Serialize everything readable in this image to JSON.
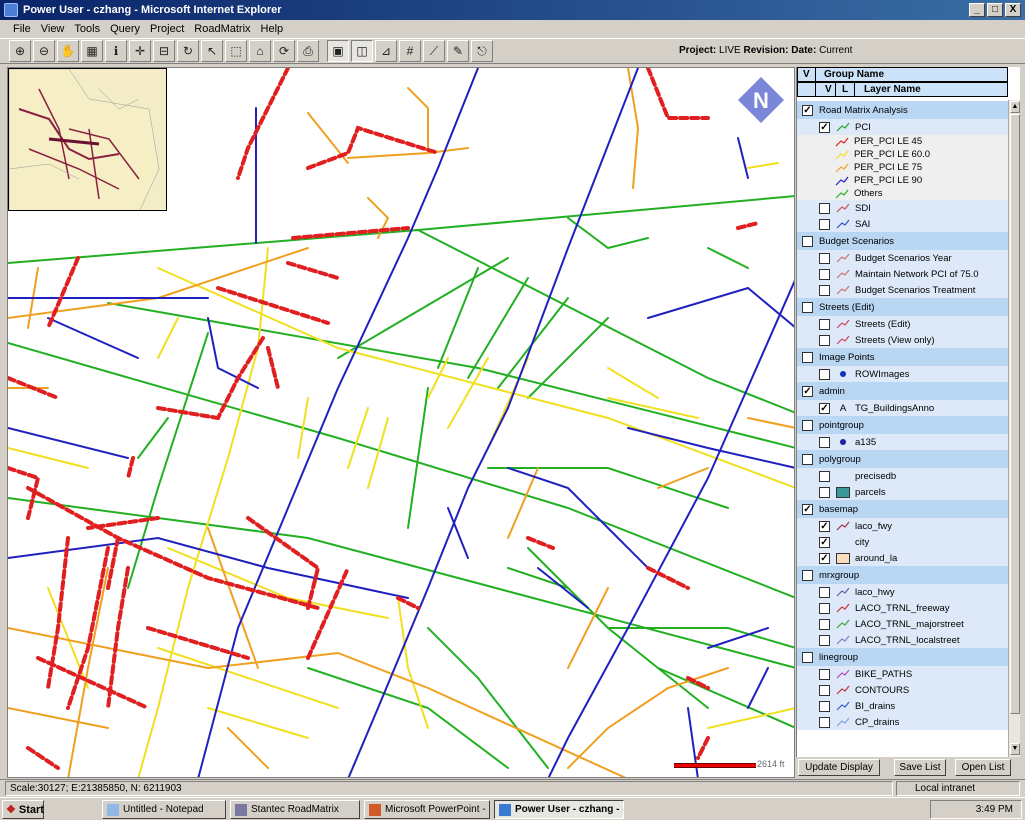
{
  "window": {
    "title": "Power User - czhang - Microsoft Internet Explorer",
    "controls": [
      "_",
      "□",
      "X"
    ]
  },
  "menu": [
    "File",
    "View",
    "Tools",
    "Query",
    "Project",
    "RoadMatrix",
    "Help"
  ],
  "toolbar": {
    "tools": [
      "zoom-in",
      "zoom-out",
      "pan",
      "table",
      "identify",
      "full-extent",
      "measure",
      "refresh",
      "select",
      "select-box",
      "clear-selection",
      "reload",
      "print",
      "map-layer",
      "toggle-panel",
      "grid-snap",
      "snap",
      "split",
      "edit",
      "pdf"
    ],
    "project_label": "Project:",
    "project_value": "LIVE",
    "revision_label": "Revision:",
    "date_label": "Date:",
    "date_value": "Current"
  },
  "panel": {
    "header_v": "V",
    "header_group": "Group Name",
    "header_v2": "V",
    "header_l": "L",
    "header_layer": "Layer Name",
    "rows": [
      {
        "type": "group",
        "checked": true,
        "label": "Road Matrix Analysis"
      },
      {
        "type": "sub",
        "checked": true,
        "label": "PCI",
        "sym": "line",
        "color": "#2aa02a"
      },
      {
        "type": "legend",
        "label": "PER_PCI LE 45",
        "color": "#e02020"
      },
      {
        "type": "legend",
        "label": "PER_PCI LE 60.0",
        "color": "#f0e020"
      },
      {
        "type": "legend",
        "label": "PER_PCI LE 75",
        "color": "#f0a020"
      },
      {
        "type": "legend",
        "label": "PER_PCI LE 90",
        "color": "#2020c0"
      },
      {
        "type": "legend",
        "label": "Others",
        "color": "#20b020"
      },
      {
        "type": "sub",
        "checked": false,
        "label": "SDI",
        "sym": "line",
        "color": "#d05050"
      },
      {
        "type": "sub",
        "checked": false,
        "label": "SAI",
        "sym": "line",
        "color": "#3050c0"
      },
      {
        "type": "group",
        "checked": false,
        "label": "Budget Scenarios"
      },
      {
        "type": "sub",
        "checked": false,
        "label": "Budget Scenarios Year",
        "sym": "line",
        "color": "#d07070"
      },
      {
        "type": "sub",
        "checked": false,
        "label": "Maintain Network PCI of 75.0",
        "sym": "line",
        "color": "#d07070"
      },
      {
        "type": "sub",
        "checked": false,
        "label": "Budget Scenarios Treatment",
        "sym": "line",
        "color": "#d07070"
      },
      {
        "type": "group",
        "checked": false,
        "label": "Streets (Edit)"
      },
      {
        "type": "sub",
        "checked": false,
        "label": "Streets (Edit)",
        "sym": "line",
        "color": "#d04060"
      },
      {
        "type": "sub",
        "checked": false,
        "label": "Streets (View only)",
        "sym": "line",
        "color": "#d04060"
      },
      {
        "type": "group",
        "checked": false,
        "label": "Image Points"
      },
      {
        "type": "sub",
        "checked": false,
        "label": "ROWImages",
        "sym": "dot",
        "color": "#1030c0"
      },
      {
        "type": "group",
        "checked": true,
        "label": "admin"
      },
      {
        "type": "sub",
        "checked": true,
        "label": "TG_BuildingsAnno",
        "sym": "text",
        "color": "#000000"
      },
      {
        "type": "group",
        "checked": false,
        "label": "pointgroup"
      },
      {
        "type": "sub",
        "checked": false,
        "label": "a135",
        "sym": "dot",
        "color": "#2020a0"
      },
      {
        "type": "group",
        "checked": false,
        "label": "polygroup"
      },
      {
        "type": "sub",
        "checked": false,
        "label": "precisedb",
        "sym": "none",
        "color": "#ffffff"
      },
      {
        "type": "sub",
        "checked": false,
        "label": "parcels",
        "sym": "fill",
        "color": "#3a9a9a"
      },
      {
        "type": "group",
        "checked": true,
        "label": "basemap"
      },
      {
        "type": "sub",
        "checked": true,
        "label": "laco_fwy",
        "sym": "line",
        "color": "#a03050"
      },
      {
        "type": "sub",
        "checked": true,
        "label": "city",
        "sym": "none",
        "color": "#ffffff"
      },
      {
        "type": "sub",
        "checked": true,
        "label": "around_la",
        "sym": "fill",
        "color": "#f8dcc0"
      },
      {
        "type": "group",
        "checked": false,
        "label": "mrxgroup"
      },
      {
        "type": "sub",
        "checked": false,
        "label": "laco_hwy",
        "sym": "line",
        "color": "#6060a0"
      },
      {
        "type": "sub",
        "checked": false,
        "label": "LACO_TRNL_freeway",
        "sym": "line",
        "color": "#d03030"
      },
      {
        "type": "sub",
        "checked": false,
        "label": "LACO_TRNL_majorstreet",
        "sym": "line",
        "color": "#40a040"
      },
      {
        "type": "sub",
        "checked": false,
        "label": "LACO_TRNL_localstreet",
        "sym": "line",
        "color": "#8080c0"
      },
      {
        "type": "group",
        "checked": false,
        "label": "linegroup"
      },
      {
        "type": "sub",
        "checked": false,
        "label": "BIKE_PATHS",
        "sym": "line",
        "color": "#c040c0"
      },
      {
        "type": "sub",
        "checked": false,
        "label": "CONTOURS",
        "sym": "line",
        "color": "#c03030"
      },
      {
        "type": "sub",
        "checked": false,
        "label": "BI_drains",
        "sym": "line",
        "color": "#3060d0"
      },
      {
        "type": "sub",
        "checked": false,
        "label": "CP_drains",
        "sym": "line",
        "color": "#80a0e0"
      }
    ],
    "buttons": {
      "update": "Update Display",
      "save": "Save List",
      "open": "Open List"
    }
  },
  "map": {
    "scale_text": "2614 ft"
  },
  "status": {
    "coords": "Scale:30127; E:21385850, N: 6211903",
    "zone": "Local intranet"
  },
  "taskbar": {
    "start": "Start",
    "tasks": [
      "Untitled - Notepad",
      "Stantec RoadMatrix",
      "Microsoft PowerPoint - [...",
      "Power User - czhang - ..."
    ],
    "time": "3:49 PM"
  },
  "colors": {
    "pci_le45": "#e02020",
    "pci_le60": "#f0e020",
    "pci_le75": "#f0a020",
    "pci_le90": "#2020c0",
    "pci_other": "#20b020"
  }
}
